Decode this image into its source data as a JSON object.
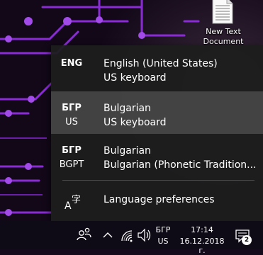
{
  "desktop": {
    "icon_label_line1": "New Text",
    "icon_label_line2": "Document"
  },
  "language_flyout": {
    "languages": [
      {
        "code": "ENG",
        "variant": "",
        "name": "English (United States)",
        "keyboard": "US keyboard",
        "selected": false
      },
      {
        "code": "БГР",
        "variant": "US",
        "name": "Bulgarian",
        "keyboard": "US keyboard",
        "selected": true
      },
      {
        "code": "БГР",
        "variant": "BGPT",
        "name": "Bulgarian",
        "keyboard": "Bulgarian (Phonetic Tradition...",
        "selected": false
      }
    ],
    "preferences_label": "Language preferences"
  },
  "taskbar": {
    "input_indicator": {
      "line1": "БГР",
      "line2": "US"
    },
    "clock": {
      "time": "17:14",
      "date": "16.12.2018 г."
    },
    "notifications_count": "2"
  },
  "colors": {
    "flyout_bg": "#1e1e1e",
    "selected_row": "#474747",
    "taskbar_bg": "#0f0b16",
    "wallpaper_circuit": "#8a2bd6"
  }
}
